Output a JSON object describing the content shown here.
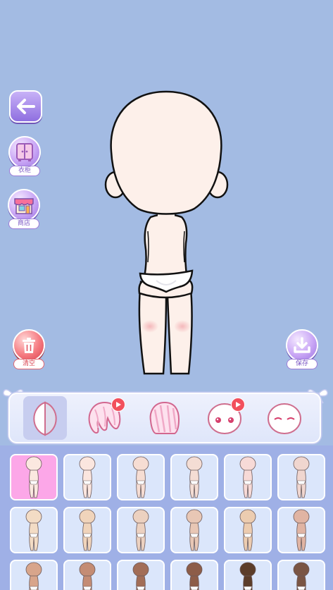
{
  "wardrobe_label": "衣柜",
  "shop_label": "商店",
  "clear_label": "清空",
  "save_label": "保存",
  "colors": {
    "background": "#a3bbe3",
    "grid_panel": "#9fb0e6",
    "selected_cell": "#fca7e8"
  },
  "categories": [
    {
      "name": "skin-tone",
      "selected": true,
      "video": false
    },
    {
      "name": "back-hair",
      "selected": false,
      "video": true
    },
    {
      "name": "front-hair",
      "selected": false,
      "video": false
    },
    {
      "name": "face",
      "selected": false,
      "video": true
    },
    {
      "name": "expression",
      "selected": false,
      "video": false
    }
  ],
  "skin_tones": [
    "#fbe8e0",
    "#fbe6df",
    "#f6ddd3",
    "#f4ddd4",
    "#f7dad7",
    "#f0d6cf",
    "#f3dcc5",
    "#f0d4bb",
    "#ecd1c0",
    "#e8c7b5",
    "#ecccb0",
    "#e0b4a3",
    "#d8a58b",
    "#c48c74",
    "#a26d57",
    "#8d5d48",
    "#5c3d2a",
    "#7a5544"
  ],
  "selected_skin_index": 0
}
